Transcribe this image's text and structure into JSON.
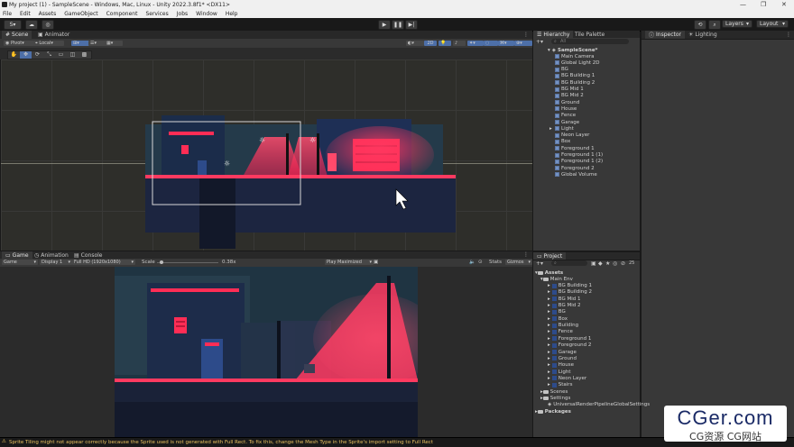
{
  "window": {
    "title": "My project (1) - SampleScene - Windows, Mac, Linux - Unity 2022.3.8f1* <DX11>",
    "controls": [
      "—",
      "❐",
      "✕"
    ]
  },
  "menu": [
    "File",
    "Edit",
    "Assets",
    "GameObject",
    "Component",
    "Services",
    "Jobs",
    "Window",
    "Help"
  ],
  "toolbar": {
    "account_label": "S",
    "layers_label": "Layers",
    "layout_label": "Layout"
  },
  "scene_panel": {
    "tabs": [
      "Scene",
      "Animator"
    ],
    "pivot_label": "Pivot",
    "local_label": "Local",
    "mode_2d": "2D"
  },
  "hierarchy": {
    "tabs": [
      "Hierarchy",
      "Tile Palette"
    ],
    "search_placeholder": "All",
    "scene_name": "SampleScene*",
    "items": [
      "Main Camera",
      "Global Light 2D",
      "BG",
      "BG Building 1",
      "BG Building 2",
      "BG Mid 1",
      "BG Mid 2",
      "Ground",
      "House",
      "Fence",
      "Garage",
      "Light",
      "Neon Layer",
      "Box",
      "Foreground 1",
      "Foreground 1 (1)",
      "Foreground 1 (2)",
      "Foreground 2",
      "Global Volume"
    ]
  },
  "inspector": {
    "tabs": [
      "Inspector",
      "Lighting"
    ]
  },
  "game_panel": {
    "tabs": [
      "Game",
      "Animation",
      "Console"
    ],
    "game_dropdown": "Game",
    "display_dropdown": "Display 1",
    "resolution_dropdown": "Full HD (1920x1080)",
    "scale_label": "Scale",
    "scale_value": "0.38x",
    "play_mode": "Play Maximized",
    "stats_label": "Stats",
    "gizmos_label": "Gizmos",
    "scale_fraction": 0.05
  },
  "project": {
    "tab": "Project",
    "count_badge": "25",
    "root": "Assets",
    "folder": "Main Env",
    "assets": [
      "BG Building 1",
      "BG Building 2",
      "BG Mid 1",
      "BG Mid 2",
      "BG",
      "Box",
      "Building",
      "Fence",
      "Foreground 1",
      "Foreground 2",
      "Garage",
      "Ground",
      "House",
      "Light",
      "Neon Layer",
      "Stairs"
    ],
    "other_folders": [
      "Scenes",
      "Settings"
    ],
    "pipeline_asset": "UniversalRenderPipelineGlobalSettings",
    "packages": "Packages"
  },
  "status": {
    "message": "Sprite Tiling might not appear correctly because the Sprite used is not generated with Full Rect. To fix this, change the Mesh Type in the Sprite's import setting to Full Rect"
  },
  "watermark": {
    "title": "CGer.com",
    "subtitle": "CG资源 CG网站"
  },
  "colors": {
    "neon": "#ff2d55",
    "panel": "#383838",
    "dark": "#191919",
    "scene_bg": "#2e2e2a"
  }
}
